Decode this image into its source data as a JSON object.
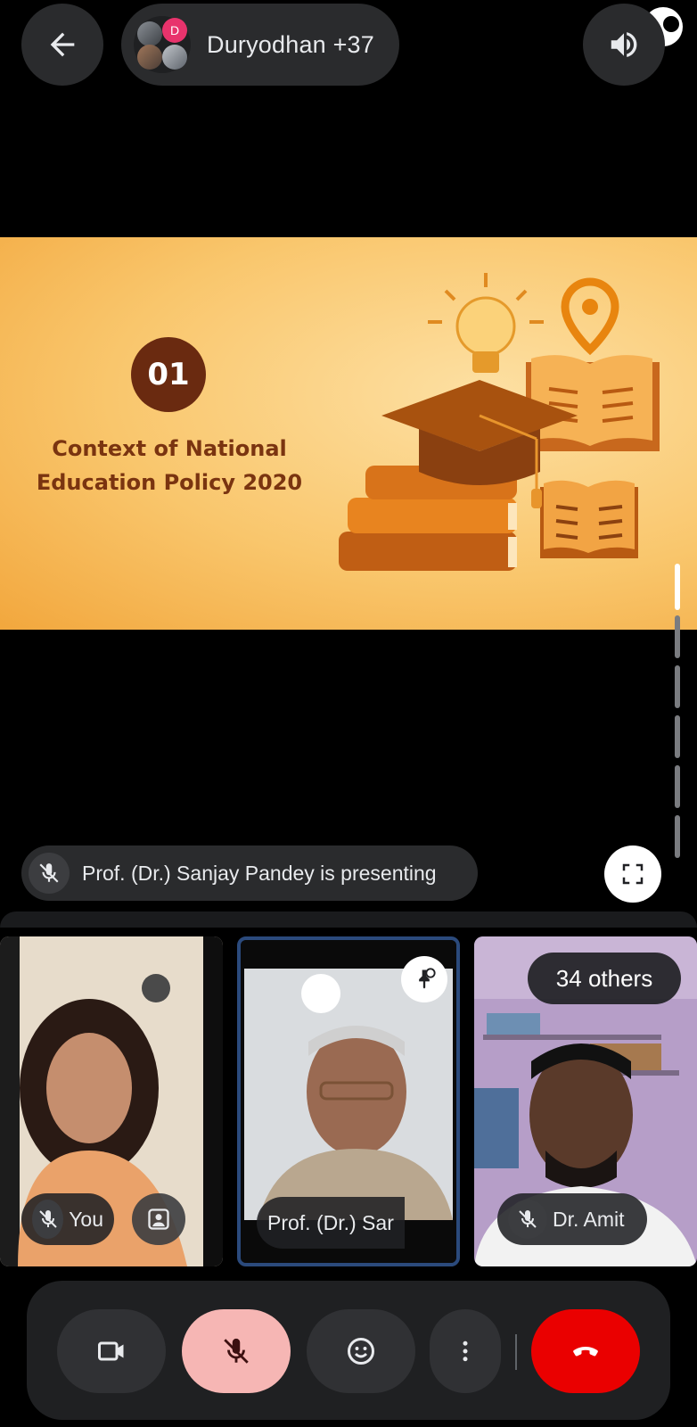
{
  "header": {
    "participants_label": "Duryodhan +37",
    "avatar_initial": "D"
  },
  "slide": {
    "number": "01",
    "title_line1": "Context of National",
    "title_line2": "Education Policy 2020"
  },
  "presenting": {
    "text": "Prof. (Dr.) Sanjay Pandey is presenting"
  },
  "tiles": [
    {
      "label": "You"
    },
    {
      "label": "Prof. (Dr.) Sar"
    },
    {
      "label": "Dr. Amit",
      "overlay": "34 others"
    }
  ],
  "colors": {
    "end_call": "#ea0000",
    "mic_muted_bg": "#f6b6b4",
    "slide_accent": "#6a2a10"
  }
}
